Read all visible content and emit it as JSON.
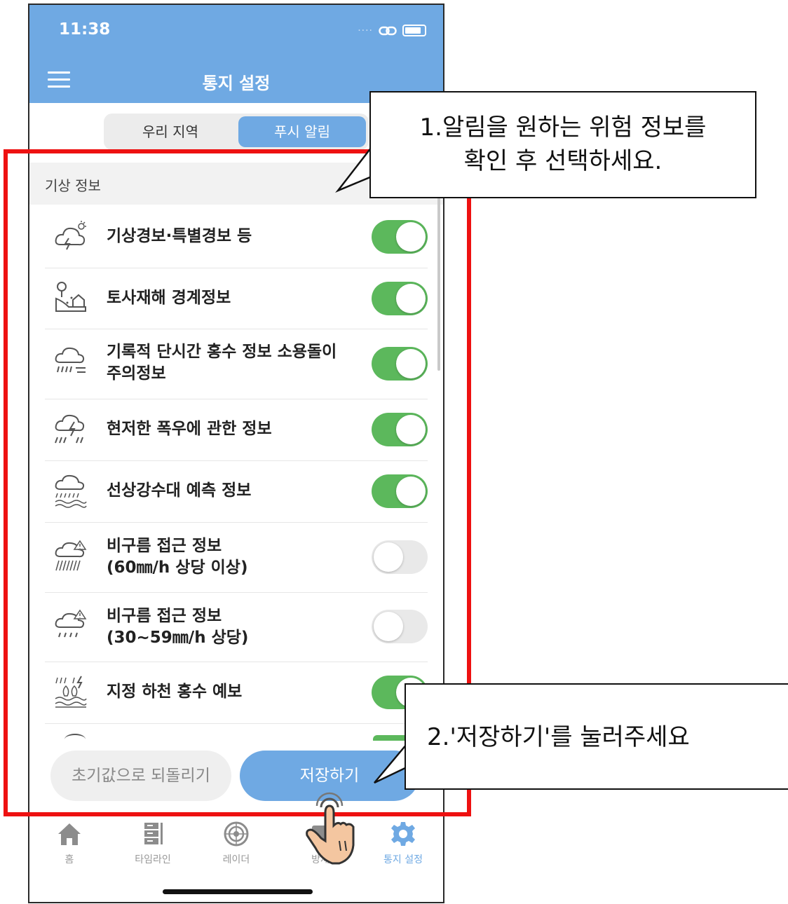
{
  "status_bar": {
    "time": "11:38"
  },
  "nav": {
    "title": "통지 설정"
  },
  "segment": {
    "tabs": [
      "우리 지역",
      "푸시 알림"
    ],
    "active_index": 1
  },
  "section": {
    "title": "기상 정보"
  },
  "items": [
    {
      "label": "기상경보·특별경보 등",
      "icon": "storm-cloud-icon",
      "enabled": true
    },
    {
      "label": "토사재해 경계정보",
      "icon": "landslide-house-icon",
      "enabled": true
    },
    {
      "label": "기록적 단시간 홍수 정보 소용돌이 주의정보",
      "icon": "heavy-rain-wind-icon",
      "enabled": true
    },
    {
      "label": "현저한 폭우에 관한 정보",
      "icon": "lightning-rain-icon",
      "enabled": true
    },
    {
      "label": "선상강수대 예측 정보",
      "icon": "rain-band-icon",
      "enabled": true
    },
    {
      "label": "비구름 접근 정보",
      "label_line2": "(60㎜/h 상당 이상)",
      "icon": "rain-cloud-warning-icon",
      "enabled": false
    },
    {
      "label": "비구름 접근 정보",
      "label_line2": "(30~59㎜/h 상당)",
      "icon": "light-rain-cloud-warning-icon",
      "enabled": false
    },
    {
      "label": "지정 하천 홍수 예보",
      "icon": "river-flood-icon",
      "enabled": true
    }
  ],
  "buttons": {
    "reset": "초기값으로 되돌리기",
    "save": "저장하기"
  },
  "tabbar": {
    "tabs": [
      {
        "label": "홈",
        "icon": "home-icon"
      },
      {
        "label": "타임라인",
        "icon": "timeline-icon"
      },
      {
        "label": "레이더",
        "icon": "radar-icon"
      },
      {
        "label": "방재",
        "icon": "disaster-icon"
      },
      {
        "label": "통지 설정",
        "icon": "gear-icon"
      }
    ],
    "active_index": 4
  },
  "callouts": {
    "first_line1": "1.알림을 원하는 위험 정보를",
    "first_line2": "확인 후 선택하세요.",
    "second": "2.'저장하기'를 눌러주세요"
  },
  "colors": {
    "accent": "#6fa9e3",
    "toggle_on": "#5cb85c",
    "highlight": "#ee1111"
  }
}
